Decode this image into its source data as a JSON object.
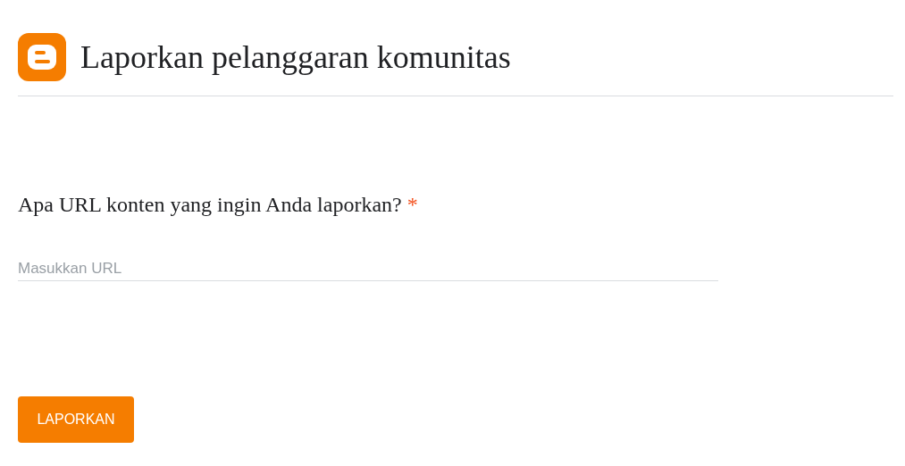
{
  "header": {
    "title": "Laporkan pelanggaran komunitas"
  },
  "question": {
    "text": "Apa URL konten yang ingin Anda laporkan?",
    "required_mark": "*"
  },
  "url_field": {
    "placeholder": "Masukkan URL"
  },
  "submit_button": {
    "label": "LAPORKAN"
  }
}
